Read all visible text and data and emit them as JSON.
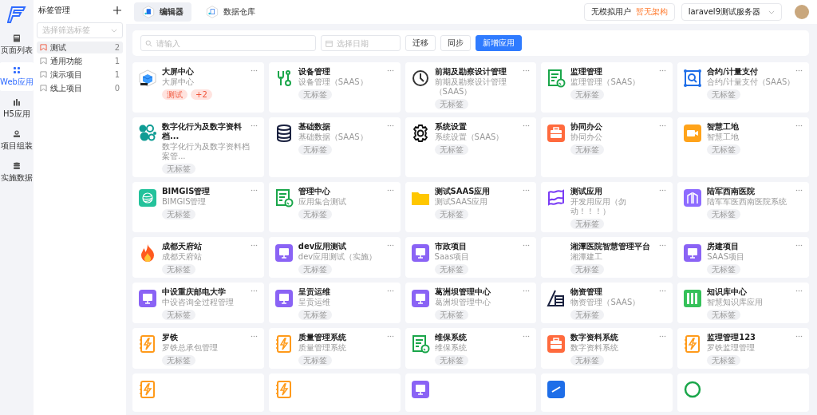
{
  "rail": {
    "items": [
      {
        "label": "页面列表",
        "selected": false
      },
      {
        "label": "Web应用",
        "selected": true
      },
      {
        "label": "H5应用",
        "selected": false
      },
      {
        "label": "项目组装",
        "selected": false
      },
      {
        "label": "实施数据",
        "selected": false
      }
    ]
  },
  "tag_panel": {
    "title": "标签管理",
    "select": {
      "placeholder": "选择筛选标签"
    },
    "items": [
      {
        "label": "测试",
        "count": "2",
        "selected": true
      },
      {
        "label": "通用功能",
        "count": "1",
        "selected": false
      },
      {
        "label": "演示项目",
        "count": "1",
        "selected": false
      },
      {
        "label": "线上项目",
        "count": "0",
        "selected": false
      }
    ]
  },
  "top_tabs": [
    {
      "label": "编辑器",
      "selected": true
    },
    {
      "label": "数据仓库",
      "selected": false
    }
  ],
  "user": {
    "label": "无模拟用户",
    "value": "暂无架构"
  },
  "server_select": {
    "value": "laravel9测试服务器"
  },
  "filters": {
    "search": {
      "placeholder": "请输入"
    },
    "date": {
      "placeholder": "选择日期"
    },
    "buttons": [
      {
        "label": "迁移",
        "kind": "default"
      },
      {
        "label": "同步",
        "kind": "default"
      },
      {
        "label": "新增应用",
        "kind": "primary"
      }
    ]
  },
  "apps": [
    {
      "title": "大屏中心",
      "subtitle": "大屏中心",
      "tags": [
        {
          "text": "测试",
          "kind": "tag"
        },
        {
          "text": "+2",
          "kind": "tag"
        }
      ]
    },
    {
      "title": "设备管理",
      "subtitle": "设备管理（SAAS）",
      "tags": [
        {
          "text": "无标签",
          "kind": "empty"
        }
      ]
    },
    {
      "title": "前期及勘察设计管理",
      "subtitle": "前期及勘察设计管理（SAAS）",
      "tags": [
        {
          "text": "无标签",
          "kind": "empty"
        }
      ]
    },
    {
      "title": "监理管理",
      "subtitle": "监理管理（SAAS）",
      "tags": [
        {
          "text": "无标签",
          "kind": "empty"
        }
      ]
    },
    {
      "title": "合约/计量支付",
      "subtitle": "合约/计量支付（SAAS）",
      "tags": [
        {
          "text": "无标签",
          "kind": "empty"
        }
      ]
    },
    {
      "title": "数字化行为及数字资料档...",
      "subtitle": "数字化行为及数字资料档案管...",
      "tags": [
        {
          "text": "无标签",
          "kind": "empty"
        }
      ]
    },
    {
      "title": "基础数据",
      "subtitle": "基础数据（SAAS）",
      "tags": [
        {
          "text": "无标签",
          "kind": "empty"
        }
      ]
    },
    {
      "title": "系统设置",
      "subtitle": "系统设置（SAAS）",
      "tags": [
        {
          "text": "无标签",
          "kind": "empty"
        }
      ]
    },
    {
      "title": "协同办公",
      "subtitle": "协同办公",
      "tags": [
        {
          "text": "无标签",
          "kind": "empty"
        }
      ]
    },
    {
      "title": "智慧工地",
      "subtitle": "智慧工地",
      "tags": [
        {
          "text": "无标签",
          "kind": "empty"
        }
      ]
    },
    {
      "title": "BIMGIS管理",
      "subtitle": "BIMGIS管理",
      "tags": [
        {
          "text": "无标签",
          "kind": "empty"
        }
      ]
    },
    {
      "title": "管理中心",
      "subtitle": "应用集合测试",
      "tags": [
        {
          "text": "无标签",
          "kind": "empty"
        }
      ]
    },
    {
      "title": "测试SAAS应用",
      "subtitle": "测试SAAS应用",
      "tags": [
        {
          "text": "无标签",
          "kind": "empty"
        }
      ]
    },
    {
      "title": "测试应用",
      "subtitle": "开发用应用（勿动！！！）",
      "tags": [
        {
          "text": "无标签",
          "kind": "empty"
        }
      ]
    },
    {
      "title": "陆军西南医院",
      "subtitle": "陆军军医西南医院系统",
      "tags": [
        {
          "text": "无标签",
          "kind": "empty"
        }
      ]
    },
    {
      "title": "成都天府站",
      "subtitle": "成都天府站",
      "tags": [
        {
          "text": "无标签",
          "kind": "empty"
        }
      ]
    },
    {
      "title": "dev应用测试",
      "subtitle": "dev应用测试（实施）",
      "tags": [
        {
          "text": "无标签",
          "kind": "empty"
        }
      ]
    },
    {
      "title": "市政项目",
      "subtitle": "Saas项目",
      "tags": [
        {
          "text": "无标签",
          "kind": "empty"
        }
      ]
    },
    {
      "title": "湘潭医院智慧管理平台",
      "subtitle": "湘潭建工",
      "tags": [
        {
          "text": "无标签",
          "kind": "empty"
        }
      ]
    },
    {
      "title": "房建项目",
      "subtitle": "SAAS项目",
      "tags": [
        {
          "text": "无标签",
          "kind": "empty"
        }
      ]
    },
    {
      "title": "中设重庆邮电大学",
      "subtitle": "中设咨询全过程管理",
      "tags": [
        {
          "text": "无标签",
          "kind": "empty"
        }
      ]
    },
    {
      "title": "呈贡运维",
      "subtitle": "呈贡运维",
      "tags": [
        {
          "text": "无标签",
          "kind": "empty"
        }
      ]
    },
    {
      "title": "葛洲坝管理中心",
      "subtitle": "葛洲坝管理中心",
      "tags": [
        {
          "text": "无标签",
          "kind": "empty"
        }
      ]
    },
    {
      "title": "物资管理",
      "subtitle": "物资管理（SAAS）",
      "tags": [
        {
          "text": "无标签",
          "kind": "empty"
        }
      ]
    },
    {
      "title": "知识库中心",
      "subtitle": "智慧知识库应用",
      "tags": [
        {
          "text": "无标签",
          "kind": "empty"
        }
      ]
    },
    {
      "title": "罗铁",
      "subtitle": "罗铁总承包管理",
      "tags": [
        {
          "text": "无标签",
          "kind": "empty"
        }
      ]
    },
    {
      "title": "质量管理系统",
      "subtitle": "质量管理系统",
      "tags": [
        {
          "text": "无标签",
          "kind": "empty"
        }
      ]
    },
    {
      "title": "维保系统",
      "subtitle": "维保系统",
      "tags": [
        {
          "text": "无标签",
          "kind": "empty"
        }
      ]
    },
    {
      "title": "数字资料系统",
      "subtitle": "数字资料系统",
      "tags": [
        {
          "text": "无标签",
          "kind": "empty"
        }
      ]
    },
    {
      "title": "监理管理123",
      "subtitle": "罗铁监理管理",
      "tags": [
        {
          "text": "无标签",
          "kind": "empty"
        }
      ]
    }
  ]
}
